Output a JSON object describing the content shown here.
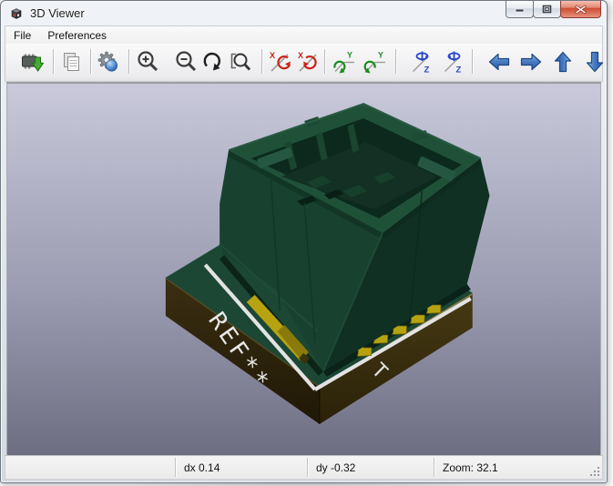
{
  "window": {
    "title": "3D Viewer"
  },
  "menu": {
    "items": [
      {
        "label": "File"
      },
      {
        "label": "Preferences"
      }
    ]
  },
  "toolbar": {
    "icons": [
      "reload-board",
      "copy-image",
      "display-options",
      "zoom-in",
      "zoom-out",
      "redraw-view",
      "zoom-fit",
      "rotate-x-pos",
      "rotate-x-neg",
      "rotate-y-pos",
      "rotate-y-neg",
      "rotate-z-pos",
      "rotate-z-neg",
      "pan-left",
      "pan-right",
      "pan-up",
      "pan-down"
    ],
    "axis": {
      "x": "X",
      "y": "Y",
      "z": "Z"
    }
  },
  "viewport": {
    "silkscreen_ref": "REF**",
    "silkscreen_marker": "T",
    "colors": {
      "background_top": "#c9c9db",
      "background_bottom": "#6e6e83",
      "component_green": "#18422f",
      "pcb_green": "#1b4734",
      "pcb_edge_brown": "#3b2f12",
      "pad_gold": "#b7a30f",
      "silkscreen_white": "#e3e3e3"
    }
  },
  "statusbar": {
    "field1": "",
    "dx": "dx 0.14",
    "dy": "dy -0.32",
    "zoom": "Zoom: 32.1"
  }
}
